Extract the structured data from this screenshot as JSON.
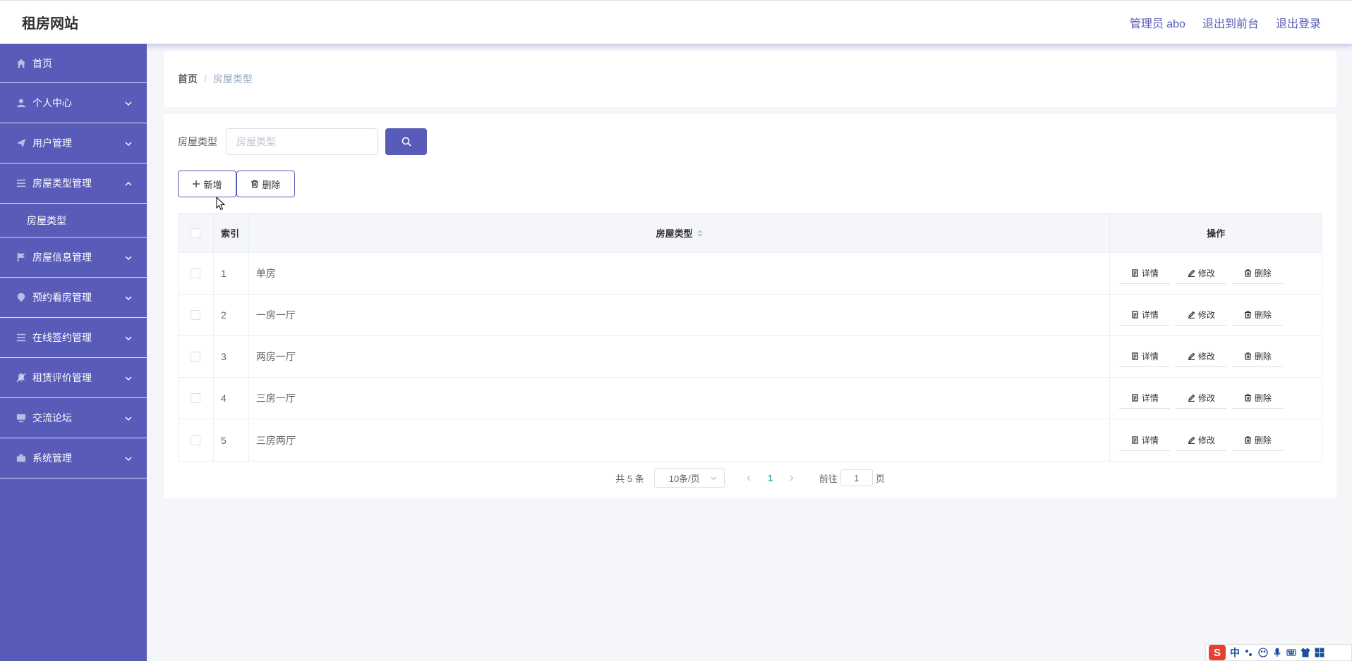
{
  "header": {
    "title": "租房网站",
    "admin_label": "管理员 abo",
    "to_front_label": "退出到前台",
    "logout_label": "退出登录"
  },
  "sidebar": {
    "items": [
      {
        "label": "首页",
        "icon": "home-icon"
      },
      {
        "label": "个人中心",
        "icon": "user-icon"
      },
      {
        "label": "用户管理",
        "icon": "send-icon"
      },
      {
        "label": "房屋类型管理",
        "icon": "menu-icon",
        "expanded": true,
        "children": [
          {
            "label": "房屋类型"
          }
        ]
      },
      {
        "label": "房屋信息管理",
        "icon": "flag-icon"
      },
      {
        "label": "预约看房管理",
        "icon": "location-icon"
      },
      {
        "label": "在线签约管理",
        "icon": "list-icon"
      },
      {
        "label": "租赁评价管理",
        "icon": "bell-off-icon"
      },
      {
        "label": "交流论坛",
        "icon": "monitor-icon"
      },
      {
        "label": "系统管理",
        "icon": "briefcase-icon"
      }
    ]
  },
  "breadcrumb": {
    "home": "首页",
    "separator": "/",
    "current": "房屋类型"
  },
  "search": {
    "label": "房屋类型",
    "placeholder": "房屋类型",
    "value": ""
  },
  "actions": {
    "add_label": "新增",
    "delete_label": "删除"
  },
  "table": {
    "headers": {
      "index": "索引",
      "type": "房屋类型",
      "ops": "操作"
    },
    "row_buttons": {
      "detail": "详情",
      "edit": "修改",
      "delete": "删除"
    },
    "rows": [
      {
        "index": "1",
        "type": "单房"
      },
      {
        "index": "2",
        "type": "一房一厅"
      },
      {
        "index": "3",
        "type": "两房一厅"
      },
      {
        "index": "4",
        "type": "三房一厅"
      },
      {
        "index": "5",
        "type": "三房两厅"
      }
    ]
  },
  "pagination": {
    "total": "共 5 条",
    "page_size": "10条/页",
    "current_page": "1",
    "goto_prefix": "前往",
    "goto_value": "1",
    "goto_suffix": "页"
  },
  "ime": {
    "logo": "S",
    "mode": "中"
  },
  "colors": {
    "primary": "#585bb7",
    "active_page": "#26b1b6",
    "background": "#f5f6fa"
  }
}
